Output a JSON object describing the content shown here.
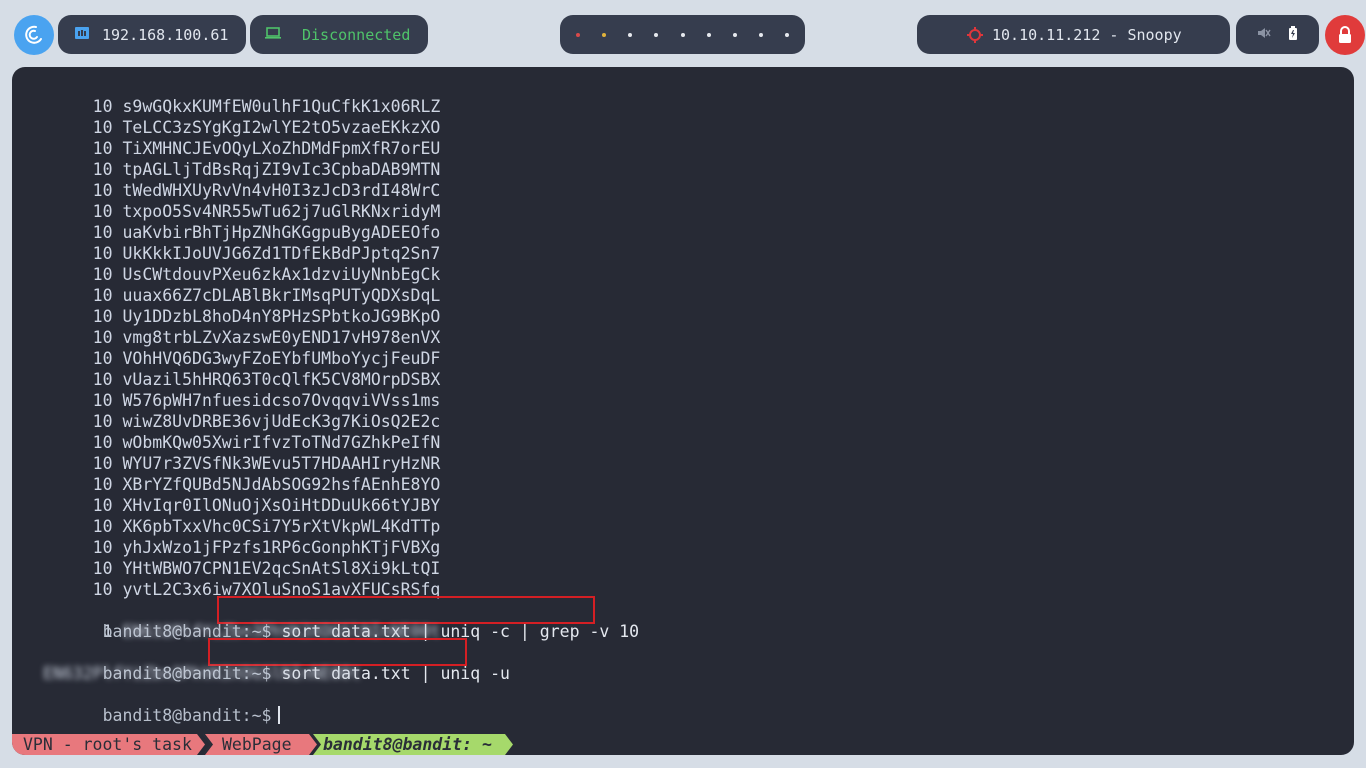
{
  "topbar": {
    "local_ip": "192.168.100.61",
    "vpn_status": "Disconnected",
    "target": "10.10.11.212 - Snoopy",
    "workspace_colors": [
      "#d94a4a",
      "#e0b23b",
      "#e6e9ee",
      "#e6e9ee",
      "#e6e9ee",
      "#e6e9ee",
      "#e6e9ee",
      "#e6e9ee",
      "#e6e9ee"
    ]
  },
  "terminal": {
    "output_lines": [
      "     10 s9wGQkxKUMfEW0ulhF1QuCfkK1x06RLZ",
      "     10 TeLCC3zSYgKgI2wlYE2tO5vzaeEKkzXO",
      "     10 TiXMHNCJEvOQyLXoZhDMdFpmXfR7orEU",
      "     10 tpAGLljTdBsRqjZI9vIc3CpbaDAB9MTN",
      "     10 tWedWHXUyRvVn4vH0I3zJcD3rdI48WrC",
      "     10 txpoO5Sv4NR55wTu62j7uGlRKNxridyM",
      "     10 uaKvbirBhTjHpZNhGKGgpuBygADEEOfo",
      "     10 UkKkkIJoUVJG6Zd1TDfEkBdPJptq2Sn7",
      "     10 UsCWtdouvPXeu6zkAx1dzviUyNnbEgCk",
      "     10 uuax66Z7cDLABlBkrIMsqPUTyQDXsDqL",
      "     10 Uy1DDzbL8hoD4nY8PHzSPbtkoJG9BKpO",
      "     10 vmg8trbLZvXazswE0yEND17vH978enVX",
      "     10 VOhHVQ6DG3wyFZoEYbfUMboYycjFeuDF",
      "     10 vUazil5hHRQ63T0cQlfK5CV8MOrpDSBX",
      "     10 W576pWH7nfuesidcso7OvqqviVVss1ms",
      "     10 wiwZ8UvDRBE36vjUdEcK3g7KiOsQ2E2c",
      "     10 wObmKQw05XwirIfvzToTNd7GZhkPeIfN",
      "     10 WYU7r3ZVSfNk3WEvu5T7HDAAHIryHzNR",
      "     10 XBrYZfQUBd5NJdAbSOG92hsfAEnhE8YO",
      "     10 XHvIqr0IlONuOjXsOiHtDDuUk66tYJBY",
      "     10 XK6pbTxxVhc0CSi7Y5rXtVkpWL4KdTTp",
      "     10 yhJxWzo1jFPzfs1RP6cGonphKTjFVBXg",
      "     10 YHtWBWO7CPN1EV2qcSnAtSl8Xi9kLtQI",
      "     10 yvtL2C3x6iw7XOluSnoS1avXFUCsRSfq"
    ],
    "prompt": "bandit8@bandit:~$",
    "cmd1": "sort data.txt | uniq -c | grep -v 10",
    "result1_count": "      1",
    "result1_value": "EN632PlfYiZbn3PhVK3XOGSlNInNE00t",
    "cmd2": "sort data.txt | uniq -u",
    "result2_value": "EN632PlfYiZbn3PhVK3XOGSlNInNE00t"
  },
  "statusbar": {
    "seg1": "VPN - root's task",
    "seg2": "WebPage",
    "seg3": "bandit8@bandit: ~"
  }
}
